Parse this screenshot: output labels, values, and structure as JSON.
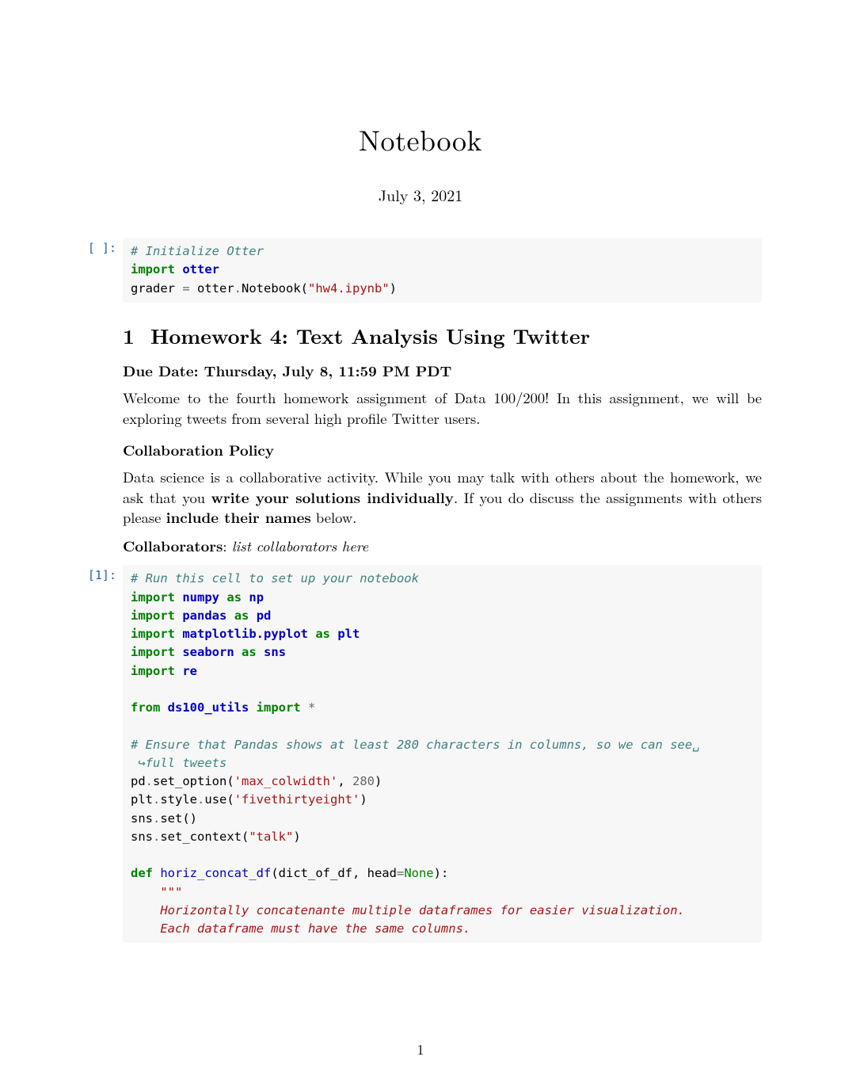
{
  "title": "Notebook",
  "date": "July 3, 2021",
  "cell0": {
    "prompt": "[ ]:",
    "c1": "# Initialize Otter",
    "c2a": "import",
    "c2b": "otter",
    "c3a": "grader ",
    "c3b": "=",
    "c3c": " otter",
    "c3d": ".",
    "c3e": "Notebook(",
    "c3f": "\"hw4.ipynb\"",
    "c3g": ")"
  },
  "section": {
    "num": "1",
    "title": "Homework 4: Text Analysis Using Twitter"
  },
  "due": "Due Date: Thursday, July 8, 11:59 PM PDT",
  "intro": "Welcome to the fourth homework assignment of Data 100/200! In this assignment, we will be exploring tweets from several high profile Twitter users.",
  "collab_head": "Collaboration Policy",
  "collab_p1a": "Data science is a collaborative activity. While you may talk with others about the homework, we ask that you ",
  "collab_p1b": "write your solutions individually",
  "collab_p1c": ". If you do discuss the assignments with others please ",
  "collab_p1d": "include their names",
  "collab_p1e": " below.",
  "collab_label": "Collaborators",
  "collab_sep": ": ",
  "collab_placeholder": "list collaborators here",
  "cell1": {
    "prompt": "[1]:",
    "c1": "# Run this cell to set up your notebook",
    "c2a": "import",
    "c2b": "numpy",
    "c2c": "as",
    "c2d": "np",
    "c3a": "import",
    "c3b": "pandas",
    "c3c": "as",
    "c3d": "pd",
    "c4a": "import",
    "c4b": "matplotlib.pyplot",
    "c4c": "as",
    "c4d": "plt",
    "c5a": "import",
    "c5b": "seaborn",
    "c5c": "as",
    "c5d": "sns",
    "c6a": "import",
    "c6b": "re",
    "c7a": "from",
    "c7b": "ds100_utils",
    "c7c": "import",
    "c7d": "*",
    "c8": "# Ensure that Pandas shows at least 280 characters in columns, so we can see␣",
    "c8b": " ↪full tweets",
    "c9a": "pd",
    "c9b": ".",
    "c9c": "set_option(",
    "c9d": "'max_colwidth'",
    "c9e": ", ",
    "c9f": "280",
    "c9g": ")",
    "c10a": "plt",
    "c10b": ".",
    "c10c": "style",
    "c10d": ".",
    "c10e": "use(",
    "c10f": "'fivethirtyeight'",
    "c10g": ")",
    "c11a": "sns",
    "c11b": ".",
    "c11c": "set()",
    "c12a": "sns",
    "c12b": ".",
    "c12c": "set_context(",
    "c12d": "\"talk\"",
    "c12e": ")",
    "c13a": "def",
    "c13b": "horiz_concat_df",
    "c13c": "(dict_of_df, head",
    "c13d": "=",
    "c13e": "None",
    "c13f": "):",
    "c14": "    \"\"\"",
    "c15": "    Horizontally concatenante multiple dataframes for easier visualization.",
    "c16": "    Each dataframe must have the same columns."
  },
  "page_number": "1"
}
